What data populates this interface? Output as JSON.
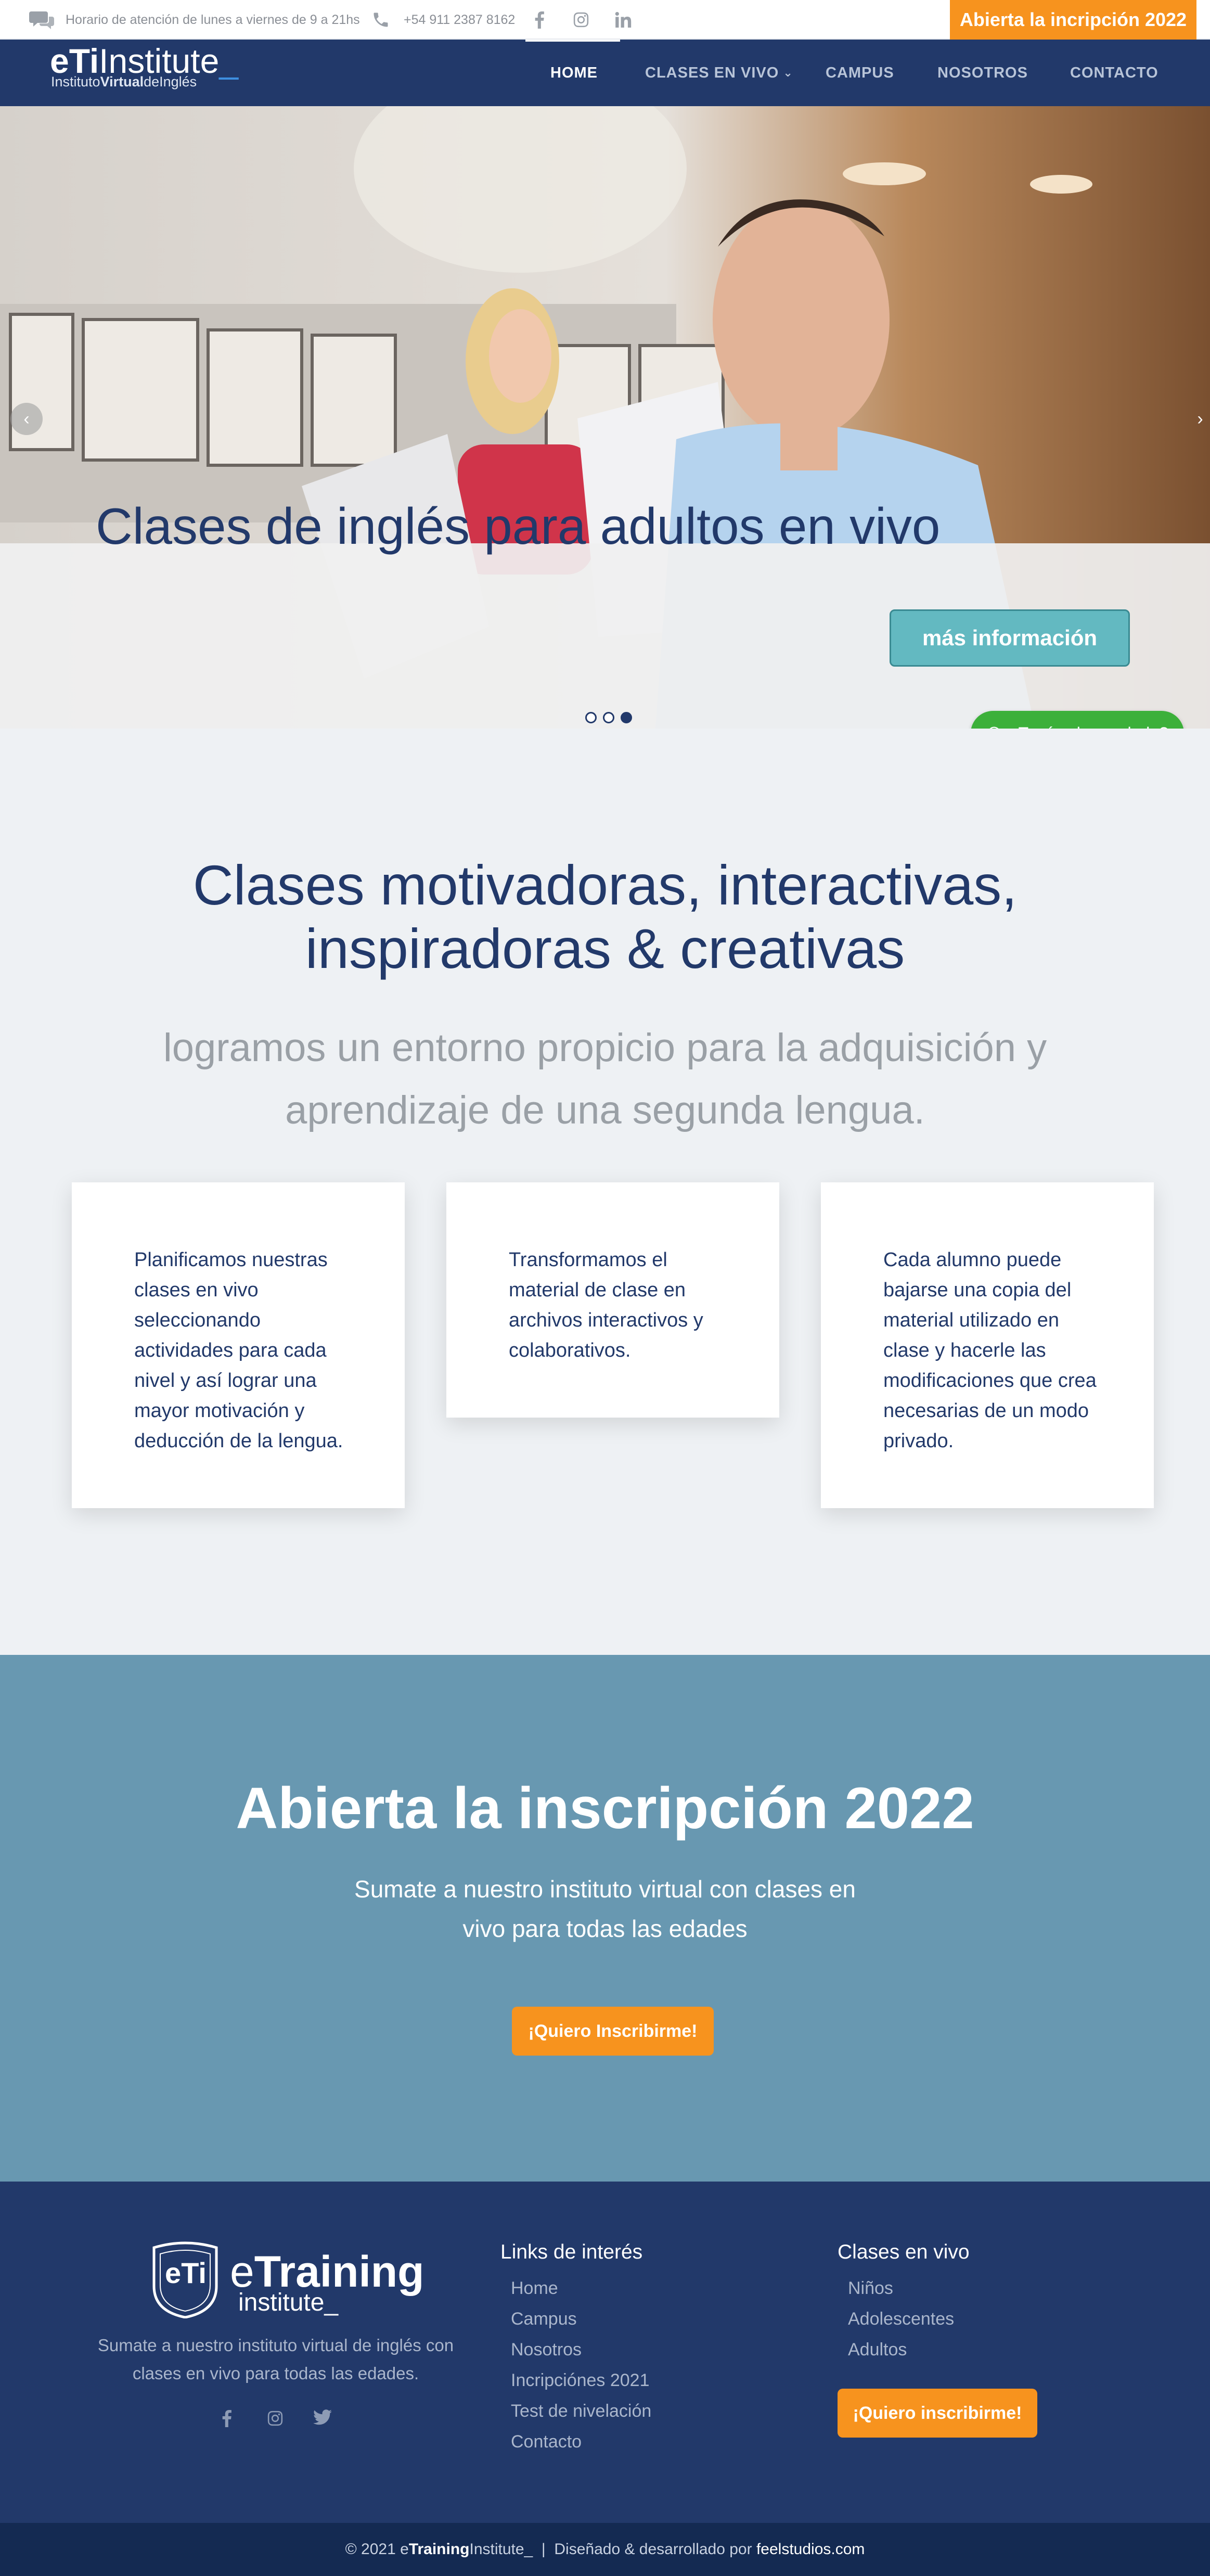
{
  "topbar": {
    "hours": "Horario de atención de lunes a viernes de 9 a 21hs",
    "phone": "+54 911 2387 8162",
    "cta": "Abierta la incripción 2022"
  },
  "logo": {
    "brand_bold": "eTi",
    "brand_rest": "Institute",
    "cursor": "_",
    "sub_a": "Instituto",
    "sub_b": "Virtual",
    "sub_c": "deInglés"
  },
  "nav": {
    "items": [
      "HOME",
      "CLASES EN VIVO",
      "CAMPUS",
      "NOSOTROS",
      "CONTACTO"
    ]
  },
  "hero": {
    "title": "Clases de inglés para adultos en vivo",
    "button": "más información",
    "slides_total": 3,
    "active_slide": 3
  },
  "whatsapp": "¿Tenés alguna duda?",
  "features": {
    "title_line1": "Clases motivadoras, interactivas,",
    "title_line2": "inspiradoras & creativas",
    "sub_line1": "logramos un entorno propicio para la adquisición y",
    "sub_line2": "aprendizaje de una segunda lengua.",
    "cards": [
      "Planificamos nuestras clases en vivo seleccionando actividades para cada nivel y así lograr una mayor motivación y deducción de la lengua.",
      "Transformamos el material de clase en archivos interactivos y colaborativos.",
      "Cada alumno puede bajarse una copia del material utilizado en clase y hacerle las modificaciones que crea necesarias de un modo privado."
    ]
  },
  "cta": {
    "title": "Abierta la inscripción 2022",
    "sub_line1": "Sumate a nuestro instituto virtual con clases en",
    "sub_line2": "vivo para todas las edades",
    "button": "¡Quiero Inscribirme!"
  },
  "footer": {
    "logo_badge": "eTi",
    "logo_e": "e",
    "logo_training": "Training",
    "logo_institute": "institute_",
    "desc_line1": "Sumate a nuestro instituto virtual de inglés con",
    "desc_line2": "clases en vivo para todas las edades.",
    "links_title": "Links de interés",
    "links": [
      "Home",
      "Campus",
      "Nosotros",
      "Incripciónes 2021",
      "Test de nivelación",
      "Contacto"
    ],
    "classes_title": "Clases en vivo",
    "classes": [
      "Niños",
      "Adolescentes",
      "Adultos"
    ],
    "button": "¡Quiero inscribirme!"
  },
  "copyright": {
    "prefix": "© 2021 e",
    "bold": "Training",
    "rest": "Institute_  |  Diseñado & desarrollado por ",
    "studio": "feelstudios.com"
  },
  "colors": {
    "navy": "#22396a",
    "orange": "#f7931e",
    "teal": "#63b9c1",
    "cta_bg": "#6898b1",
    "whatsapp": "#3cb03a"
  }
}
